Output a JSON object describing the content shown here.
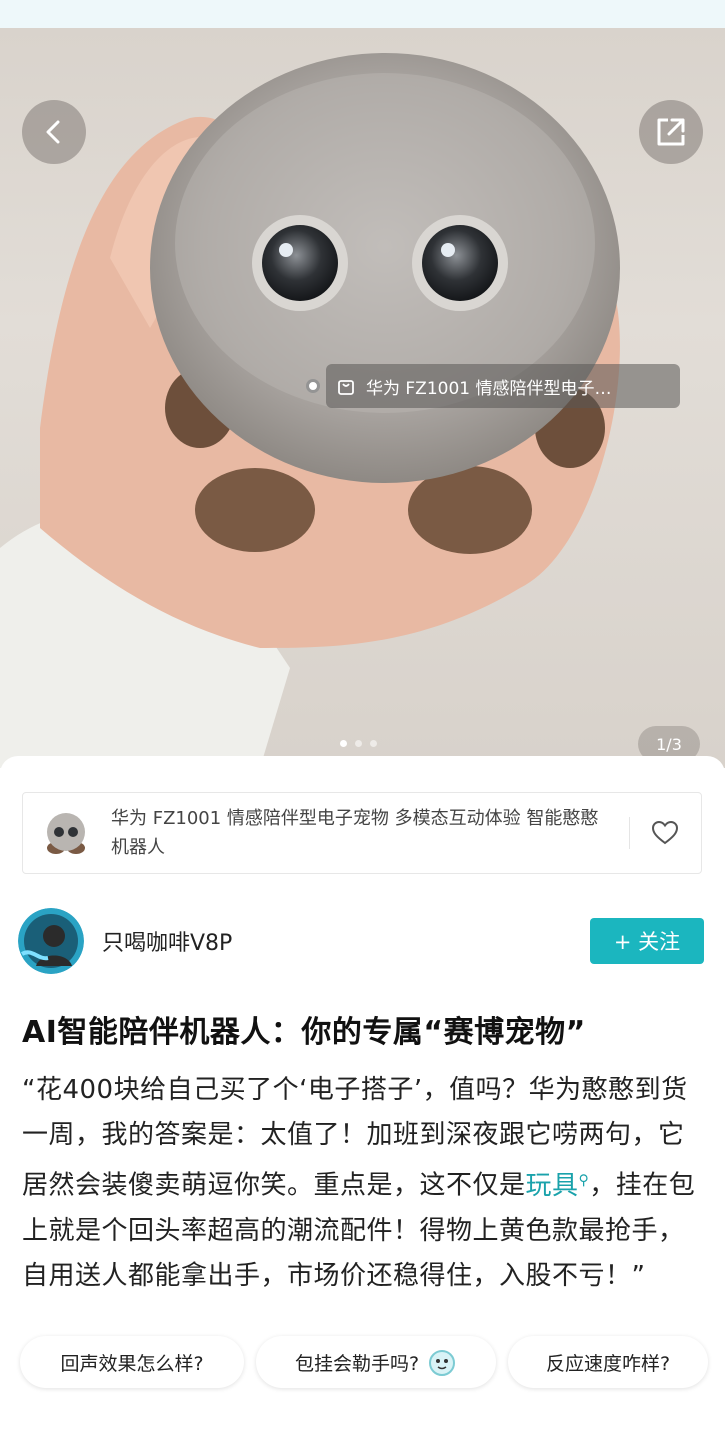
{
  "hero": {
    "back_icon": "chevron-left-icon",
    "share_icon": "share-external-icon",
    "product_tag": {
      "icon": "shopping-bag-icon",
      "text": "华为 FZ1001 情感陪伴型电子…"
    },
    "pagination": {
      "current": 1,
      "total": 3,
      "label": "1/3"
    }
  },
  "product": {
    "title": "华为 FZ1001 情感陪伴型电子宠物 多模态互动体验 智能憨憨 机器人",
    "favorite_icon": "heart-outline-icon"
  },
  "author": {
    "name": "只喝咖啡V8P",
    "follow_label": "+ 关注"
  },
  "post": {
    "title": "AI智能陪伴机器人：你的专属“赛博宠物”",
    "body_before": "“花400块给自己买了个‘电子搭子’，值吗？华为憨憨到货一周，我的答案是：太值了！加班到深夜跟它唠两句，它居然会装傻卖萌逗你笑。重点是，这不仅是",
    "keyword": "玩具",
    "body_after": "，挂在包上就是个回头率超高的潮流配件！得物上黄色款最抢手，自用送人都能拿出手，市场价还稳得住，入股不亏！”"
  },
  "questions": [
    {
      "label": "回声效果怎么样?"
    },
    {
      "label": "包挂会勒手吗?"
    },
    {
      "label": "反应速度咋样?"
    }
  ],
  "colors": {
    "accent": "#1bb6bf",
    "keyword": "#1aa2ab"
  }
}
